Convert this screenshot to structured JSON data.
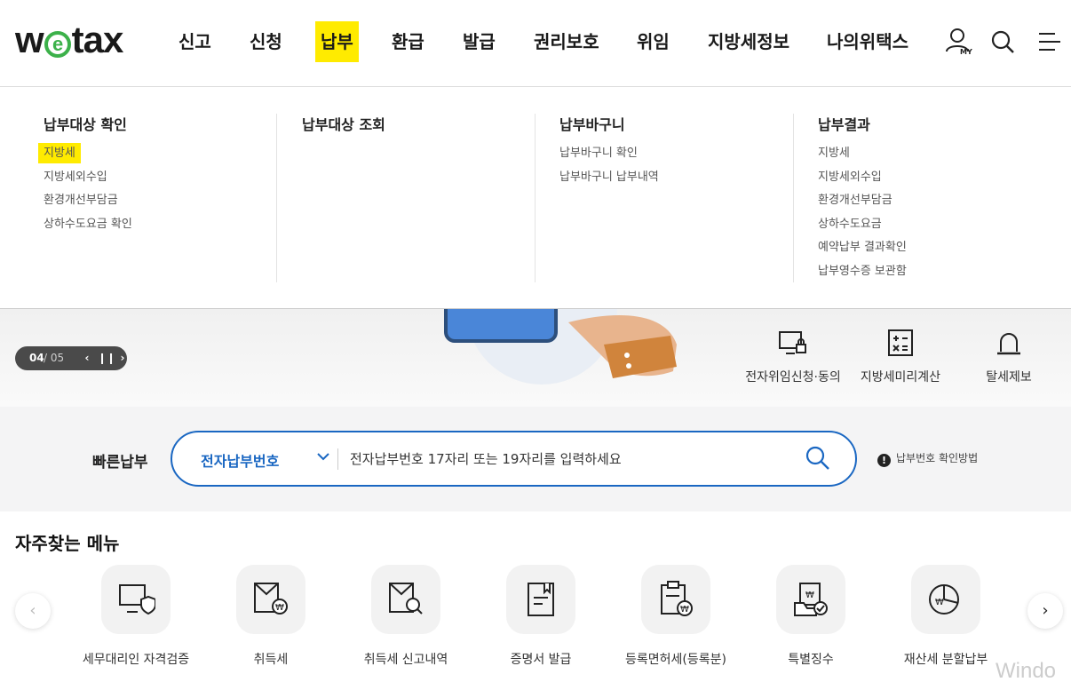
{
  "brand": {
    "logo_pre": "w",
    "logo_e": "e",
    "logo_post": "tax"
  },
  "gnb": [
    {
      "label": "신고"
    },
    {
      "label": "신청"
    },
    {
      "label": "납부"
    },
    {
      "label": "환급"
    },
    {
      "label": "발급"
    },
    {
      "label": "권리보호"
    },
    {
      "label": "위임"
    },
    {
      "label": "지방세정보"
    },
    {
      "label": "나의위택스"
    }
  ],
  "header_icons": {
    "my_label": "MY"
  },
  "mega_menu": [
    {
      "title": "납부대상 확인",
      "items": [
        "지방세",
        "지방세외수입",
        "환경개선부담금",
        "상하수도요금 확인"
      ]
    },
    {
      "title": "납부대상 조회",
      "items": []
    },
    {
      "title": "납부바구니",
      "items": [
        "납부바구니 확인",
        "납부바구니 납부내역"
      ]
    },
    {
      "title": "납부결과",
      "items": [
        "지방세",
        "지방세외수입",
        "환경개선부담금",
        "상하수도요금",
        "예약납부 결과확인",
        "납부영수증 보관함"
      ]
    }
  ],
  "banner": {
    "pager_current": "04",
    "pager_total": "/ 05",
    "quick_links": [
      "전자위임신청·동의",
      "지방세미리계산",
      "탈세제보"
    ]
  },
  "quick_pay": {
    "title": "빠른납부",
    "select_value": "전자납부번호",
    "placeholder": "전자납부번호 17자리 또는 19자리를 입력하세요",
    "help": "납부번호 확인방법",
    "help_mark": "!"
  },
  "favorites": {
    "title": "자주찾는 메뉴",
    "items": [
      "세무대리인 자격검증",
      "취득세",
      "취득세 신고내역",
      "증명서 발급",
      "등록면허세(등록분)",
      "특별징수",
      "재산세 분할납부"
    ],
    "prev": "‹",
    "next": "›"
  },
  "watermark": "Windo",
  "colors": {
    "accent": "#1a67c2",
    "highlight": "#ffeb00",
    "logo_green": "#3cb14a"
  }
}
